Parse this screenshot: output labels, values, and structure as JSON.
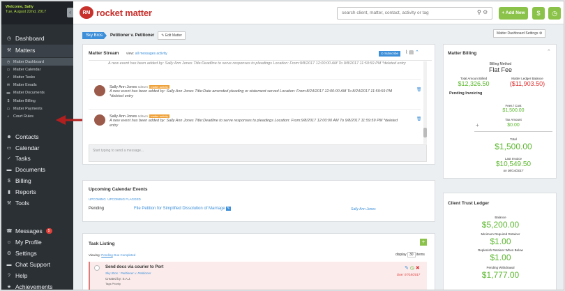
{
  "sidebar": {
    "welcome": "Welcome, Sally",
    "date": "Tue, August 22nd, 2017",
    "collapse_icon": "chevron-left-icon",
    "top_items": [
      {
        "label": "Dashboard",
        "icon": "clock-icon"
      },
      {
        "label": "Matters",
        "icon": "gavel-icon"
      }
    ],
    "matter_items": [
      {
        "label": "Matter Dashboard"
      },
      {
        "label": "Matter Calendar"
      },
      {
        "label": "Matter Tasks"
      },
      {
        "label": "Matter Emails"
      },
      {
        "label": "Matter Documents"
      },
      {
        "label": "Matter Billing"
      },
      {
        "label": "Matter Payments"
      },
      {
        "label": "Court Rules"
      }
    ],
    "main_items": [
      {
        "label": "Contacts"
      },
      {
        "label": "Calendar"
      },
      {
        "label": "Tasks"
      },
      {
        "label": "Documents"
      },
      {
        "label": "Billing"
      },
      {
        "label": "Reports"
      },
      {
        "label": "Tools"
      }
    ],
    "bottom_items": [
      {
        "label": "Messages"
      },
      {
        "label": "My Profile"
      },
      {
        "label": "Settings"
      },
      {
        "label": "Chat Support"
      },
      {
        "label": "Help"
      },
      {
        "label": "Achievements"
      }
    ],
    "messages_count": "5"
  },
  "top": {
    "logo": "rocket matter",
    "search_placeholder": "search client, matter, contact, activity or tag",
    "add_new": "+ Add New",
    "dollar": "$",
    "clock": "◷"
  },
  "crumb": {
    "client": "Sky Bros",
    "matter": "Petitioner v. Petitioner",
    "edit": "✎ Edit Matter",
    "settings": "Matter Dashboard Settings ⚙"
  },
  "stream": {
    "title": "Matter Stream",
    "view": "view:",
    "filters": [
      "all",
      "messages",
      "activity"
    ],
    "subscribe": "⊙ Subscribe",
    "top_text": "A new event has been added by: Sally Ann Jones Title:Deadline to serve responses to pleadings Location: From:9/8/2017 12:00:00 AM To 9/8/2017 11:59:59 PM *deleted entry",
    "messages": [
      {
        "name": "Sally Ann Jones",
        "time": "6d8wm",
        "tag": "matter activity",
        "text": "A new event has been added by: Sally Ann Jones Title:Date amended pleading or statement served Location: From:8/24/2017 12:00:00 AM To 8/24/2017 11:59:59 PM",
        "deleted": "*deleted entry"
      },
      {
        "name": "Sally Ann Jones",
        "time": "6d8wm",
        "tag": "matter activity",
        "text": "A new event has been added by: Sally Ann Jones Title:Deadline to serve responses to pleadings Location: From:9/8/2017 12:00:00 AM To 9/8/2017 11:59:59 PM *deleted",
        "deleted": "entry"
      }
    ],
    "input_placeholder": "Start typing to send a message..."
  },
  "calendar": {
    "title": "Upcoming Calendar Events",
    "tabs": [
      "UPCOMING",
      "UPCOMING FLAGGED"
    ],
    "status": "Pending",
    "event": "File Petition for Simplified Dissolution of Marriage",
    "person": "Sally Ann Jones"
  },
  "tasks": {
    "title": "Task Listing",
    "viewing": "Viewing:",
    "filters": [
      "Pending",
      "Due",
      "Completed"
    ],
    "display": "display",
    "count": "30",
    "items_label": "items",
    "task": {
      "title": "Send docs via courier to Port",
      "sub": "Sky Bros : Petitioner v. Petitioner",
      "created": "Created by: S.A.J.",
      "tags": "Tags Priority",
      "due": "Due: 07/18/2017"
    }
  },
  "billing": {
    "title": "Matter Billing",
    "method_label": "Billing Method",
    "method": "Flat Fee",
    "billed_label": "Total Amount Billed",
    "billed": "$12,326.50",
    "ledger_label": "Matter Ledger Balance",
    "ledger": "($11,903.50)",
    "pending_label": "Pending Invoicing",
    "fees_label": "Fees / Cost",
    "fees": "$1,500.00",
    "tax_label": "Tax Amount",
    "tax": "$0.00",
    "plus": "+",
    "total_label": "Total",
    "total": "$1,500.00",
    "last_label": "Last Invoice",
    "last": "$10,549.50",
    "last_date": "on 08/14/2017"
  },
  "trust": {
    "title": "Client Trust Ledger",
    "balance_label": "Balance",
    "balance": "$5,200.00",
    "min_label": "Minimum Required Retainer",
    "min": "$1.00",
    "replenish_label": "Replenish Retainer When Below",
    "replenish": "$1.00",
    "pending_label": "Pending Withdrawal",
    "pending": "$1,777.00"
  }
}
